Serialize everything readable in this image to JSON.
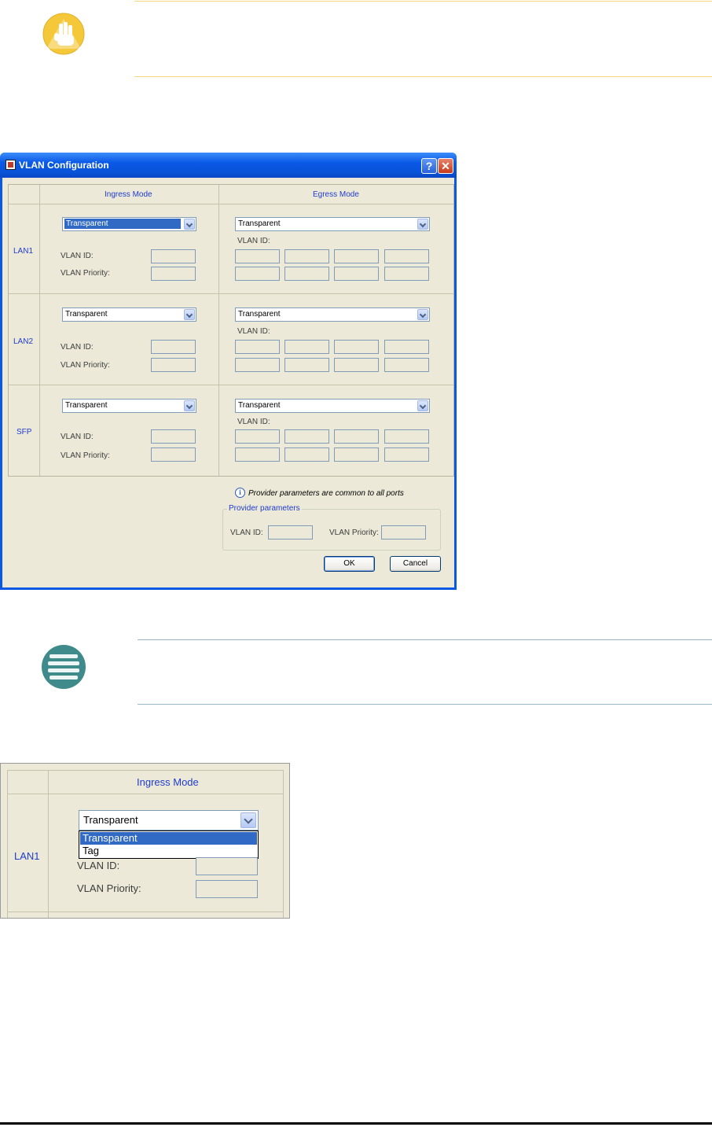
{
  "colors": {
    "warning_line": "#f0d77a",
    "note_line": "#9ab6c9",
    "accent_blue": "#1f3cd0",
    "selection": "#316ac5",
    "dialog_face": "#ece9d8"
  },
  "icons": {
    "warning": "warning-hand-icon",
    "note": "note-icon",
    "info": "info-icon"
  },
  "dialog": {
    "title": "VLAN Configuration",
    "help_glyph": "?",
    "close_glyph": "✕",
    "columns": {
      "ingress": "Ingress Mode",
      "egress": "Egress Mode"
    },
    "rows": [
      {
        "port": "LAN1",
        "ingress_mode": "Transparent",
        "egress_mode": "Transparent",
        "egress_vlan_id_label": "VLAN ID:",
        "vlan_id_label": "VLAN ID:",
        "vlan_priority_label": "VLAN Priority:"
      },
      {
        "port": "LAN2",
        "ingress_mode": "Transparent",
        "egress_mode": "Transparent",
        "egress_vlan_id_label": "VLAN ID:",
        "vlan_id_label": "VLAN ID:",
        "vlan_priority_label": "VLAN Priority:"
      },
      {
        "port": "SFP",
        "ingress_mode": "Transparent",
        "egress_mode": "Transparent",
        "egress_vlan_id_label": "VLAN ID:",
        "vlan_id_label": "VLAN ID:",
        "vlan_priority_label": "VLAN Priority:"
      }
    ],
    "info_glyph": "i",
    "info_text": "Provider parameters are common to all ports",
    "provider_group_title": "Provider parameters",
    "provider_vlan_id_label": "VLAN ID:",
    "provider_vlan_priority_label": "VLAN Priority:",
    "ok_label": "OK",
    "cancel_label": "Cancel"
  },
  "zoom": {
    "column_header": "Ingress Mode",
    "row_label": "LAN1",
    "selected_value": "Transparent",
    "options": [
      "Transparent",
      "Tag"
    ],
    "vlan_id_label": "VLAN ID:",
    "vlan_priority_label": "VLAN Priority:"
  }
}
